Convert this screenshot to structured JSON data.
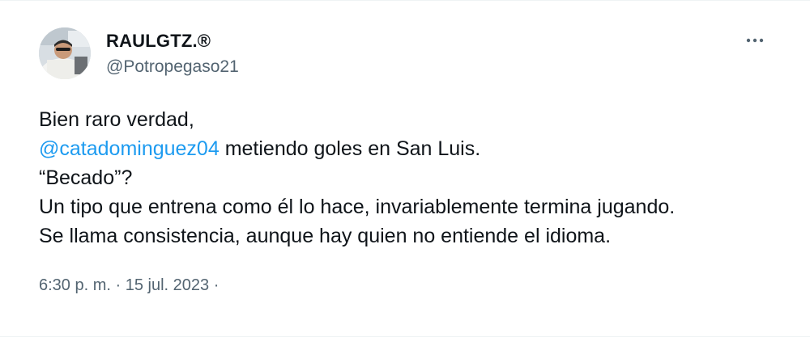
{
  "author": {
    "display_name": "RAULGTZ.®",
    "handle": "@Potropegaso21"
  },
  "tweet": {
    "line1": "Bien raro verdad,",
    "mention": "@catadominguez04",
    "line2_rest": " metiendo goles en San Luis.",
    "line3": "“Becado”?",
    "line4": "Un tipo que entrena como él lo hace, invariablemente termina jugando.",
    "line5": "Se llama consistencia, aunque hay quien no entiende el idioma."
  },
  "meta": {
    "time": "6:30 p. m.",
    "separator": "·",
    "date": "15 jul. 2023",
    "trailing_separator": "·"
  },
  "icons": {
    "more": "more-horizontal-icon",
    "avatar": "avatar"
  },
  "colors": {
    "text": "#0f1419",
    "secondary": "#536471",
    "link": "#1d9bf0",
    "divider": "#eff3f4"
  }
}
